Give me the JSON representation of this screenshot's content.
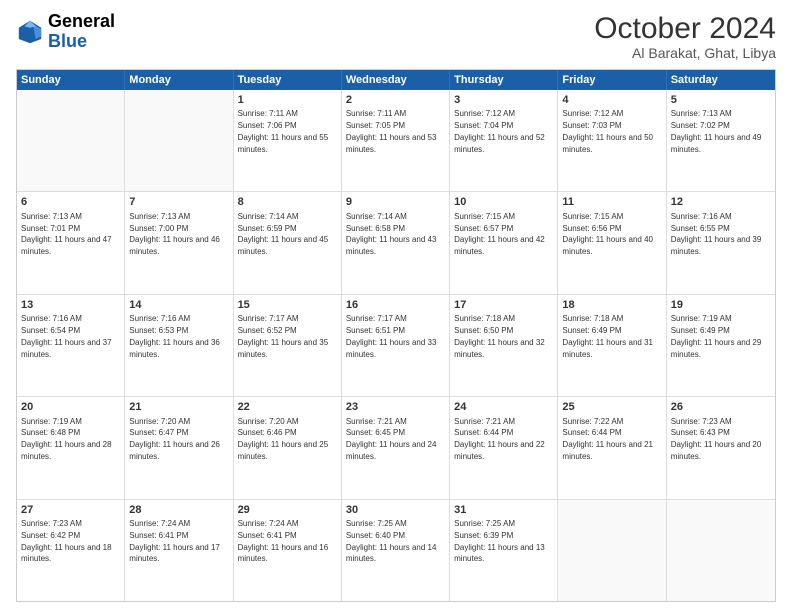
{
  "header": {
    "logo_general": "General",
    "logo_blue": "Blue",
    "month_year": "October 2024",
    "location": "Al Barakat, Ghat, Libya"
  },
  "weekdays": [
    "Sunday",
    "Monday",
    "Tuesday",
    "Wednesday",
    "Thursday",
    "Friday",
    "Saturday"
  ],
  "weeks": [
    [
      {
        "day": "",
        "sunrise": "",
        "sunset": "",
        "daylight": "",
        "empty": true
      },
      {
        "day": "",
        "sunrise": "",
        "sunset": "",
        "daylight": "",
        "empty": true
      },
      {
        "day": "1",
        "sunrise": "Sunrise: 7:11 AM",
        "sunset": "Sunset: 7:06 PM",
        "daylight": "Daylight: 11 hours and 55 minutes.",
        "empty": false
      },
      {
        "day": "2",
        "sunrise": "Sunrise: 7:11 AM",
        "sunset": "Sunset: 7:05 PM",
        "daylight": "Daylight: 11 hours and 53 minutes.",
        "empty": false
      },
      {
        "day": "3",
        "sunrise": "Sunrise: 7:12 AM",
        "sunset": "Sunset: 7:04 PM",
        "daylight": "Daylight: 11 hours and 52 minutes.",
        "empty": false
      },
      {
        "day": "4",
        "sunrise": "Sunrise: 7:12 AM",
        "sunset": "Sunset: 7:03 PM",
        "daylight": "Daylight: 11 hours and 50 minutes.",
        "empty": false
      },
      {
        "day": "5",
        "sunrise": "Sunrise: 7:13 AM",
        "sunset": "Sunset: 7:02 PM",
        "daylight": "Daylight: 11 hours and 49 minutes.",
        "empty": false
      }
    ],
    [
      {
        "day": "6",
        "sunrise": "Sunrise: 7:13 AM",
        "sunset": "Sunset: 7:01 PM",
        "daylight": "Daylight: 11 hours and 47 minutes.",
        "empty": false
      },
      {
        "day": "7",
        "sunrise": "Sunrise: 7:13 AM",
        "sunset": "Sunset: 7:00 PM",
        "daylight": "Daylight: 11 hours and 46 minutes.",
        "empty": false
      },
      {
        "day": "8",
        "sunrise": "Sunrise: 7:14 AM",
        "sunset": "Sunset: 6:59 PM",
        "daylight": "Daylight: 11 hours and 45 minutes.",
        "empty": false
      },
      {
        "day": "9",
        "sunrise": "Sunrise: 7:14 AM",
        "sunset": "Sunset: 6:58 PM",
        "daylight": "Daylight: 11 hours and 43 minutes.",
        "empty": false
      },
      {
        "day": "10",
        "sunrise": "Sunrise: 7:15 AM",
        "sunset": "Sunset: 6:57 PM",
        "daylight": "Daylight: 11 hours and 42 minutes.",
        "empty": false
      },
      {
        "day": "11",
        "sunrise": "Sunrise: 7:15 AM",
        "sunset": "Sunset: 6:56 PM",
        "daylight": "Daylight: 11 hours and 40 minutes.",
        "empty": false
      },
      {
        "day": "12",
        "sunrise": "Sunrise: 7:16 AM",
        "sunset": "Sunset: 6:55 PM",
        "daylight": "Daylight: 11 hours and 39 minutes.",
        "empty": false
      }
    ],
    [
      {
        "day": "13",
        "sunrise": "Sunrise: 7:16 AM",
        "sunset": "Sunset: 6:54 PM",
        "daylight": "Daylight: 11 hours and 37 minutes.",
        "empty": false
      },
      {
        "day": "14",
        "sunrise": "Sunrise: 7:16 AM",
        "sunset": "Sunset: 6:53 PM",
        "daylight": "Daylight: 11 hours and 36 minutes.",
        "empty": false
      },
      {
        "day": "15",
        "sunrise": "Sunrise: 7:17 AM",
        "sunset": "Sunset: 6:52 PM",
        "daylight": "Daylight: 11 hours and 35 minutes.",
        "empty": false
      },
      {
        "day": "16",
        "sunrise": "Sunrise: 7:17 AM",
        "sunset": "Sunset: 6:51 PM",
        "daylight": "Daylight: 11 hours and 33 minutes.",
        "empty": false
      },
      {
        "day": "17",
        "sunrise": "Sunrise: 7:18 AM",
        "sunset": "Sunset: 6:50 PM",
        "daylight": "Daylight: 11 hours and 32 minutes.",
        "empty": false
      },
      {
        "day": "18",
        "sunrise": "Sunrise: 7:18 AM",
        "sunset": "Sunset: 6:49 PM",
        "daylight": "Daylight: 11 hours and 31 minutes.",
        "empty": false
      },
      {
        "day": "19",
        "sunrise": "Sunrise: 7:19 AM",
        "sunset": "Sunset: 6:49 PM",
        "daylight": "Daylight: 11 hours and 29 minutes.",
        "empty": false
      }
    ],
    [
      {
        "day": "20",
        "sunrise": "Sunrise: 7:19 AM",
        "sunset": "Sunset: 6:48 PM",
        "daylight": "Daylight: 11 hours and 28 minutes.",
        "empty": false
      },
      {
        "day": "21",
        "sunrise": "Sunrise: 7:20 AM",
        "sunset": "Sunset: 6:47 PM",
        "daylight": "Daylight: 11 hours and 26 minutes.",
        "empty": false
      },
      {
        "day": "22",
        "sunrise": "Sunrise: 7:20 AM",
        "sunset": "Sunset: 6:46 PM",
        "daylight": "Daylight: 11 hours and 25 minutes.",
        "empty": false
      },
      {
        "day": "23",
        "sunrise": "Sunrise: 7:21 AM",
        "sunset": "Sunset: 6:45 PM",
        "daylight": "Daylight: 11 hours and 24 minutes.",
        "empty": false
      },
      {
        "day": "24",
        "sunrise": "Sunrise: 7:21 AM",
        "sunset": "Sunset: 6:44 PM",
        "daylight": "Daylight: 11 hours and 22 minutes.",
        "empty": false
      },
      {
        "day": "25",
        "sunrise": "Sunrise: 7:22 AM",
        "sunset": "Sunset: 6:44 PM",
        "daylight": "Daylight: 11 hours and 21 minutes.",
        "empty": false
      },
      {
        "day": "26",
        "sunrise": "Sunrise: 7:23 AM",
        "sunset": "Sunset: 6:43 PM",
        "daylight": "Daylight: 11 hours and 20 minutes.",
        "empty": false
      }
    ],
    [
      {
        "day": "27",
        "sunrise": "Sunrise: 7:23 AM",
        "sunset": "Sunset: 6:42 PM",
        "daylight": "Daylight: 11 hours and 18 minutes.",
        "empty": false
      },
      {
        "day": "28",
        "sunrise": "Sunrise: 7:24 AM",
        "sunset": "Sunset: 6:41 PM",
        "daylight": "Daylight: 11 hours and 17 minutes.",
        "empty": false
      },
      {
        "day": "29",
        "sunrise": "Sunrise: 7:24 AM",
        "sunset": "Sunset: 6:41 PM",
        "daylight": "Daylight: 11 hours and 16 minutes.",
        "empty": false
      },
      {
        "day": "30",
        "sunrise": "Sunrise: 7:25 AM",
        "sunset": "Sunset: 6:40 PM",
        "daylight": "Daylight: 11 hours and 14 minutes.",
        "empty": false
      },
      {
        "day": "31",
        "sunrise": "Sunrise: 7:25 AM",
        "sunset": "Sunset: 6:39 PM",
        "daylight": "Daylight: 11 hours and 13 minutes.",
        "empty": false
      },
      {
        "day": "",
        "sunrise": "",
        "sunset": "",
        "daylight": "",
        "empty": true
      },
      {
        "day": "",
        "sunrise": "",
        "sunset": "",
        "daylight": "",
        "empty": true
      }
    ]
  ]
}
